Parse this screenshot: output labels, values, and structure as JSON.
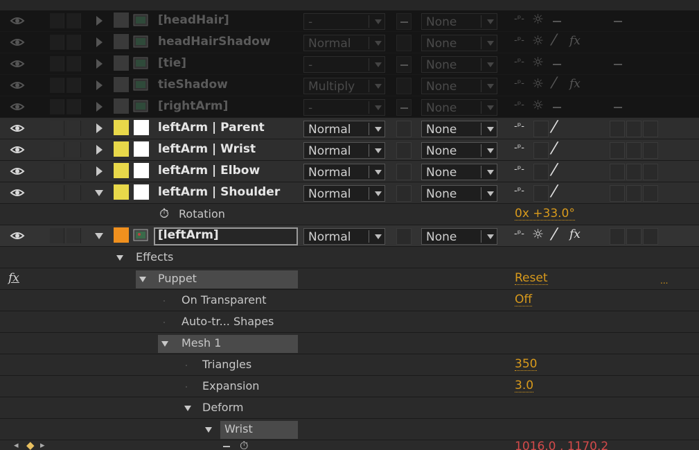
{
  "layers": [
    {
      "name": "[headHair]",
      "mode": "-",
      "track": "None",
      "has_fx": false,
      "dim": true
    },
    {
      "name": "headHairShadow",
      "mode": "Normal",
      "track": "None",
      "has_fx": true,
      "dim": true
    },
    {
      "name": "[tie]",
      "mode": "-",
      "track": "None",
      "has_fx": false,
      "dim": true
    },
    {
      "name": "tieShadow",
      "mode": "Multiply",
      "track": "None",
      "has_fx": true,
      "dim": true
    },
    {
      "name": "[rightArm]",
      "mode": "-",
      "track": "None",
      "has_fx": false,
      "dim": true
    },
    {
      "name": "leftArm | Parent",
      "mode": "Normal",
      "track": "None",
      "label_color": "#e8d84a"
    },
    {
      "name": "leftArm | Wrist",
      "mode": "Normal",
      "track": "None",
      "label_color": "#e8d84a"
    },
    {
      "name": "leftArm | Elbow",
      "mode": "Normal",
      "track": "None",
      "label_color": "#e8d84a"
    },
    {
      "name": "leftArm | Shoulder",
      "mode": "Normal",
      "track": "None",
      "label_color": "#e8d84a"
    }
  ],
  "rotation": {
    "label": "Rotation",
    "value": "0x +33.0°"
  },
  "left_arm": {
    "name": "[leftArm]",
    "mode": "Normal",
    "track": "None",
    "label_color": "#f0901e"
  },
  "effects": {
    "label": "Effects",
    "fx_symbol": "fx",
    "puppet": "Puppet",
    "reset": "Reset",
    "ellipsis": "...",
    "on_transparent": {
      "label": "On Transparent",
      "value": "Off"
    },
    "auto_trace": "Auto-tr... Shapes",
    "mesh": "Mesh 1",
    "triangles": {
      "label": "Triangles",
      "value": "350"
    },
    "expansion": {
      "label": "Expansion",
      "value": "3.0"
    },
    "deform": "Deform",
    "wrist": "Wrist",
    "position_value": "1016.0 , 1170.2"
  },
  "colors": {
    "gold": "#d89a1c",
    "red": "#d24a4a",
    "yellow_label": "#e8d84a",
    "orange_label": "#f0901e"
  }
}
